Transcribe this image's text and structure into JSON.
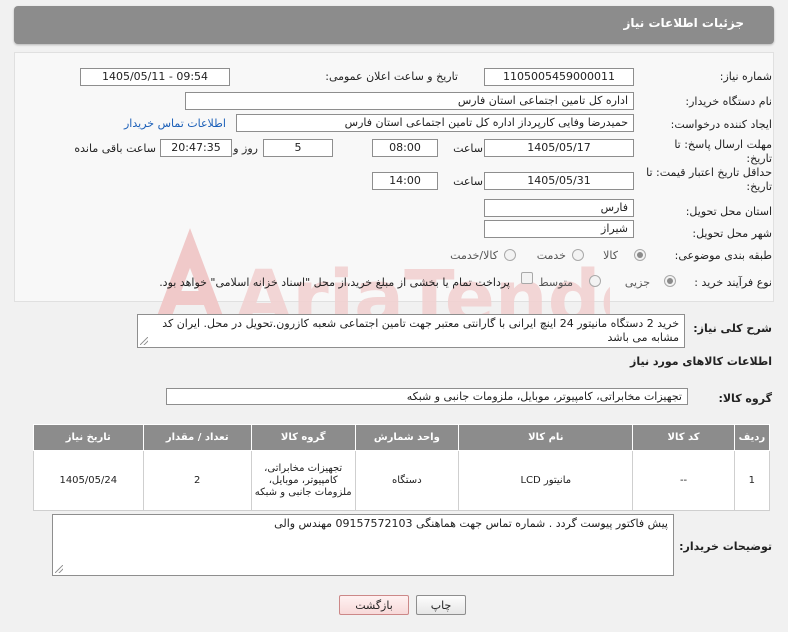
{
  "header": {
    "title": "جزئیات اطلاعات نیاز"
  },
  "need": {
    "number_label": "شماره نیاز:",
    "number": "1105005459000011",
    "announce_label": "تاریخ و ساعت اعلان عمومی:",
    "announce_value": "1405/05/11 - 09:54",
    "buyer_org_label": "نام دستگاه خریدار:",
    "buyer_org": "اداره کل تامین اجتماعی استان فارس",
    "creator_label": "ایجاد کننده درخواست:",
    "creator": "حمیدرضا وفایی کارپرداز اداره کل تامین اجتماعی استان فارس",
    "contact_link": "اطلاعات تماس خریدار",
    "deadline_label": "مهلت ارسال پاسخ: تا تاریخ:",
    "deadline_date": "1405/05/17",
    "time_word": "ساعت",
    "deadline_time": "08:00",
    "days": "5",
    "days_word": "روز و",
    "remaining_time": "20:47:35",
    "remaining_word": "ساعت باقی مانده",
    "validity_label": "حداقل تاریخ اعتبار قیمت: تا تاریخ:",
    "validity_date": "1405/05/31",
    "validity_time": "14:00",
    "province_label": "استان محل تحویل:",
    "province": "فارس",
    "city_label": "شهر محل تحویل:",
    "city": "شیراز",
    "category_label": "طبقه بندی موضوعی:",
    "category_options": [
      "کالا",
      "خدمت",
      "کالا/خدمت"
    ],
    "category_selected": "کالا",
    "process_label": "نوع فرآیند خرید :",
    "process_options": [
      "جزیی",
      "متوسط"
    ],
    "process_selected": "جزیی",
    "payment_note": "پرداخت تمام یا بخشی از مبلغ خرید،از محل \"اسناد خزانه اسلامی\" خواهد بود."
  },
  "description": {
    "label": "شرح کلی نیاز:",
    "text": "خرید 2 دستگاه مانیتور 24 اینچ ایرانی با گارانتی معتبر جهت تامین اجتماعی شعبه کازرون.تحویل در محل. ایران کد مشابه می باشد"
  },
  "goods": {
    "section_title": "اطلاعات کالاهای مورد نیاز",
    "group_label": "گروه کالا:",
    "group_value": "تجهیزات مخابراتی، کامپیوتر، موبایل، ملزومات جانبی و شبکه",
    "columns": [
      "ردیف",
      "کد کالا",
      "نام کالا",
      "واحد شمارش",
      "گروه کالا",
      "تعداد / مقدار",
      "تاریخ نیاز"
    ],
    "rows": [
      {
        "index": "1",
        "code": "--",
        "name": "مانیتور LCD",
        "unit": "دستگاه",
        "group": "تجهیزات مخابراتی، کامپیوتر، موبایل، ملزومات جانبی و شبکه",
        "qty": "2",
        "date": "1405/05/24"
      }
    ]
  },
  "buyer_notes": {
    "label": "توضیحات خریدار:",
    "text": "پیش فاکتور پیوست گردد . شماره تماس جهت هماهنگی 09157572103 مهندس والی"
  },
  "buttons": {
    "print": "چاپ",
    "back": "بازگشت"
  },
  "watermark": {
    "text": "AriaTender.net"
  },
  "colors": {
    "header": "#8c8c8c",
    "link": "#1b5fb8",
    "watermark": "#f0c7c7"
  }
}
